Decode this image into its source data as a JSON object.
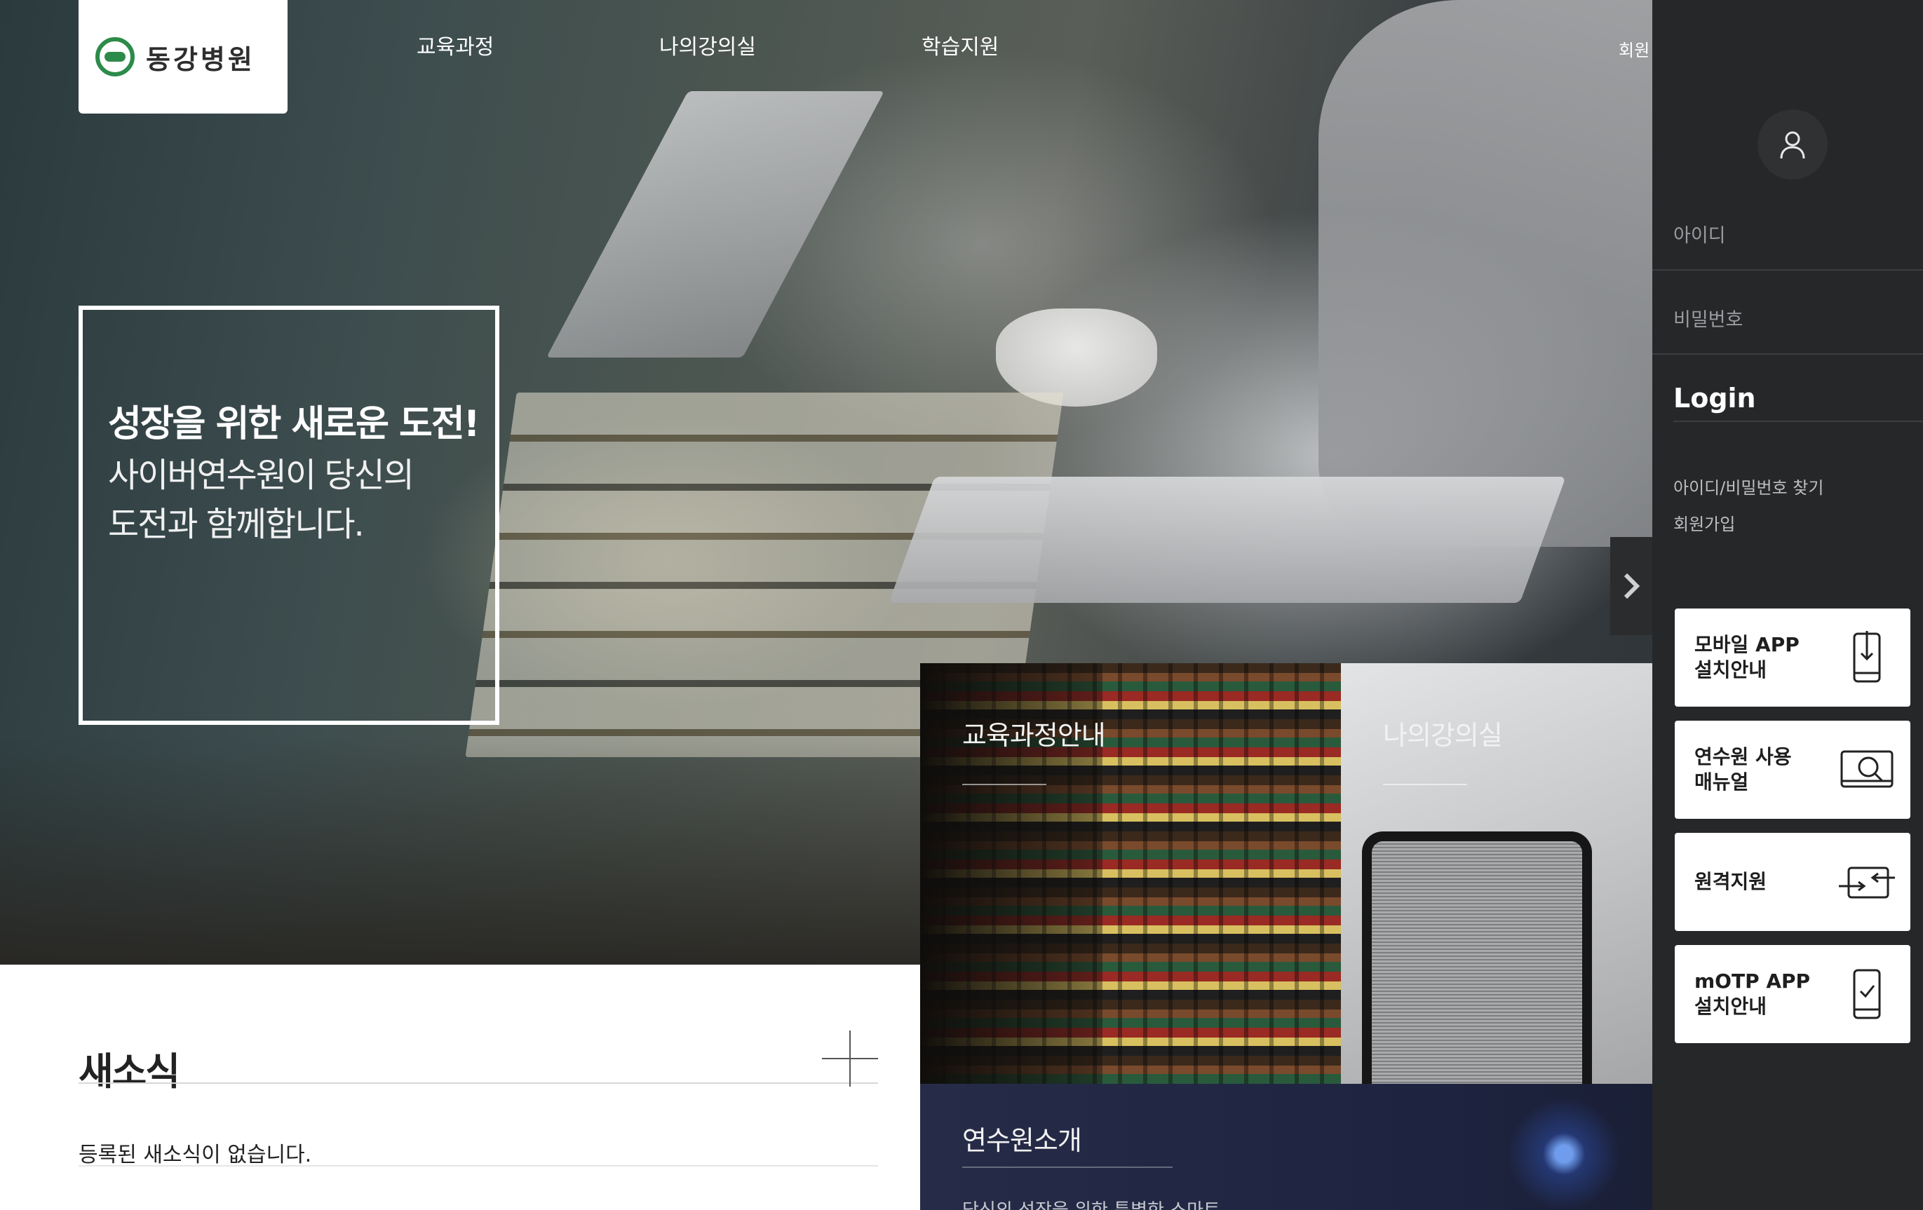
{
  "brand": {
    "name": "동강병원",
    "accent": "#2d8b4a"
  },
  "nav": {
    "items": [
      {
        "label": "교육과정"
      },
      {
        "label": "나의강의실"
      },
      {
        "label": "학습지원"
      },
      {
        "label": "회원"
      }
    ]
  },
  "hero": {
    "title": "성장을 위한 새로운 도전!",
    "subtitle_line1": "사이버연수원이 당신의",
    "subtitle_line2": "도전과 함께합니다."
  },
  "login": {
    "id_placeholder": "아이디",
    "pw_placeholder": "비밀번호",
    "login_label": "Login",
    "find_link": "아이디/비밀번호 찾기",
    "join_link": "회원가입"
  },
  "quick_links": [
    {
      "label": "모바일 APP\n설치안내",
      "icon": "mobile-download-icon"
    },
    {
      "label": "연수원 사용\n매뉴얼",
      "icon": "manual-search-icon"
    },
    {
      "label": "원격지원",
      "icon": "remote-support-icon"
    },
    {
      "label": "mOTP APP\n설치안내",
      "icon": "mobile-check-icon"
    }
  ],
  "news": {
    "title": "새소식",
    "empty_text": "등록된 새소식이 없습니다."
  },
  "tiles": {
    "courses": "교육과정안내",
    "classroom": "나의강의실",
    "about": "연수원소개",
    "about_sub": "당신의 성장을 위한 특별한 스마트"
  }
}
